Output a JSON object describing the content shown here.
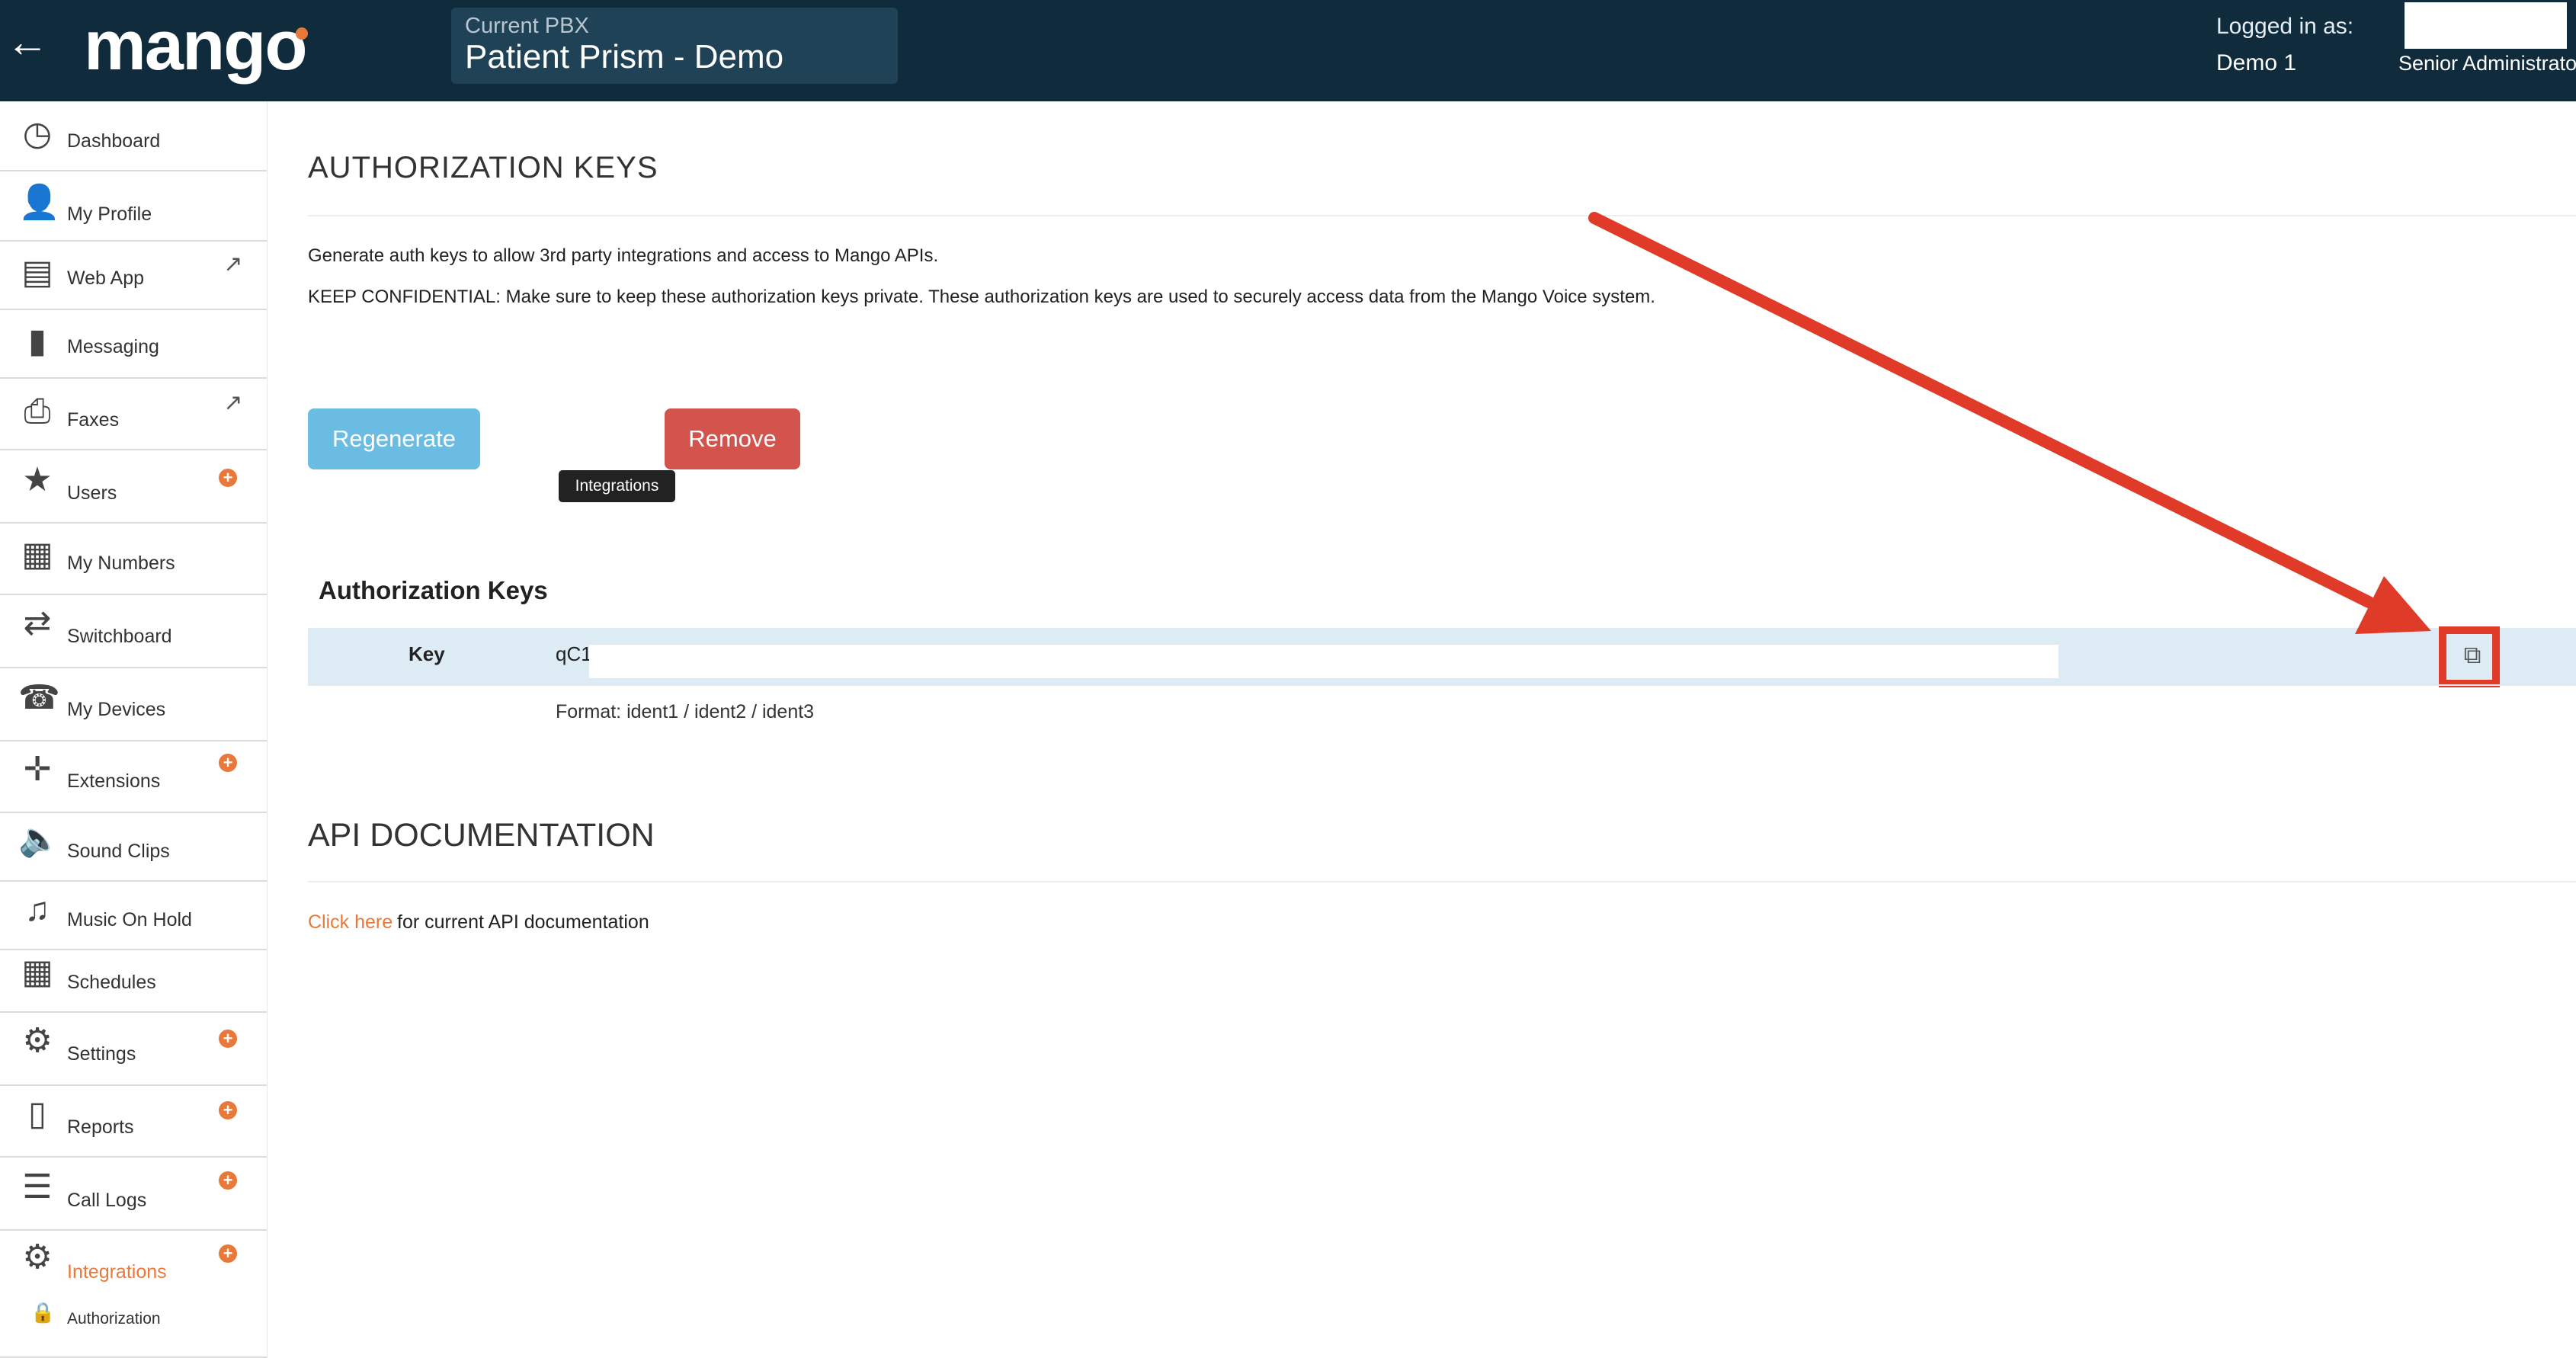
{
  "header": {
    "brand": "mango",
    "pbx_label": "Current PBX",
    "pbx_name": "Patient Prism - Demo",
    "logged_in_label": "Logged in as:",
    "user_name": "Demo 1",
    "user_role": "Senior Administrator"
  },
  "sidebar": {
    "items": [
      {
        "label": "Dashboard",
        "icon": "dashboard-icon"
      },
      {
        "label": "My Profile",
        "icon": "person-icon"
      },
      {
        "label": "Web App",
        "icon": "chat-window-icon"
      },
      {
        "label": "Messaging",
        "icon": "speech-bubble-icon"
      },
      {
        "label": "Faxes",
        "icon": "printer-icon"
      },
      {
        "label": "Users",
        "icon": "star-icon"
      },
      {
        "label": "My Numbers",
        "icon": "keypad-icon"
      },
      {
        "label": "Switchboard",
        "icon": "transfer-arrows-icon"
      },
      {
        "label": "My Devices",
        "icon": "phone-icon"
      },
      {
        "label": "Extensions",
        "icon": "extensions-icon"
      },
      {
        "label": "Sound Clips",
        "icon": "speaker-icon"
      },
      {
        "label": "Music On Hold",
        "icon": "music-note-icon"
      },
      {
        "label": "Schedules",
        "icon": "calendar-icon"
      },
      {
        "label": "Settings",
        "icon": "gear-icon"
      },
      {
        "label": "Reports",
        "icon": "bar-chart-icon"
      },
      {
        "label": "Call Logs",
        "icon": "list-icon"
      },
      {
        "label": "Integrations",
        "icon": "gear-icon"
      }
    ],
    "sub_item": {
      "label": "Authorization",
      "icon": "lock-icon"
    }
  },
  "main": {
    "auth_title": "AUTHORIZATION KEYS",
    "desc1": "Generate auth keys to allow 3rd party integrations and access to Mango APIs.",
    "desc2": "KEEP CONFIDENTIAL: Make sure to keep these authorization keys private. These authorization keys are used to securely access data from the Mango Voice system.",
    "regenerate_label": "Regenerate",
    "remove_label": "Remove",
    "tooltip": "Integrations",
    "keys_title": "Authorization Keys",
    "key_label": "Key",
    "key_value": "qC1",
    "key_format": "Format: ident1 / ident2 / ident3",
    "api_title": "API DOCUMENTATION",
    "api_link": "Click here",
    "api_text": "for current API documentation"
  },
  "colors": {
    "header_bg": "#0f2b3c",
    "accent": "#e8793a",
    "regenerate": "#6bbce2",
    "remove": "#d3544c",
    "annotation": "#e03a28"
  }
}
